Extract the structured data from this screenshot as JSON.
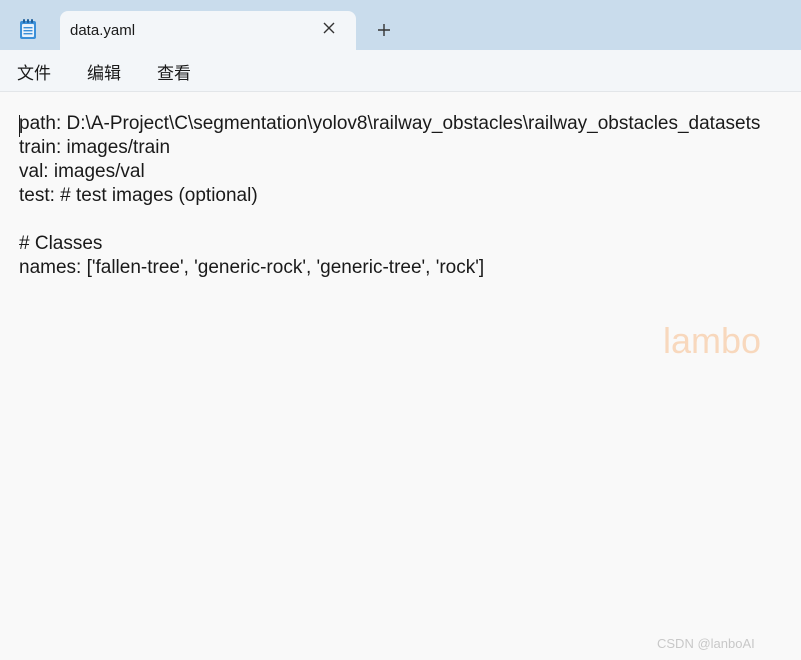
{
  "tabbar": {
    "app_icon": "notepad-icon",
    "tab_title": "data.yaml",
    "close_icon": "close-icon",
    "new_tab_icon": "plus-icon"
  },
  "menu": {
    "items": [
      "文件",
      "编辑",
      "查看"
    ]
  },
  "editor": {
    "lines": [
      "path: D:\\A-Project\\C\\segmentation\\yolov8\\railway_obstacles\\railway_obstacles_datasets",
      "train: images/train",
      "val: images/val",
      "test: # test images (optional)",
      "",
      "# Classes",
      "names: ['fallen-tree', 'generic-rock', 'generic-tree', 'rock']"
    ]
  },
  "watermarks": {
    "overlay": "lambo",
    "footer": "CSDN @lanboAI"
  },
  "colors": {
    "tabbar_bg": "#c9dcec",
    "tab_bg": "#f3f6f9",
    "editor_bg": "#f9f9f9",
    "text": "#1a1a1a",
    "watermark": "#f8d8bd"
  }
}
